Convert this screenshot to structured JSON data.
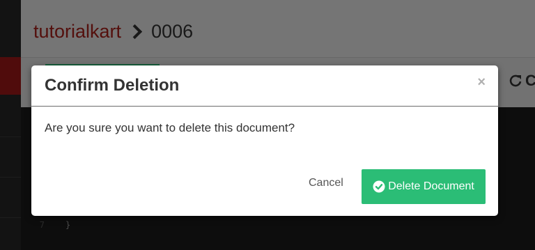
{
  "header": {
    "database": "tutorialkart",
    "document_id": "0006"
  },
  "toolbar": {
    "refresh_label": "C"
  },
  "editor": {
    "lines": [
      {
        "number": "7",
        "code": "}"
      }
    ]
  },
  "modal": {
    "title": "Confirm Deletion",
    "close_label": "×",
    "message": "Are you sure you want to delete this document?",
    "cancel_label": "Cancel",
    "delete_label": "Delete Document",
    "delete_icon": "check-circle-icon",
    "accent_color": "#2bbd76"
  }
}
